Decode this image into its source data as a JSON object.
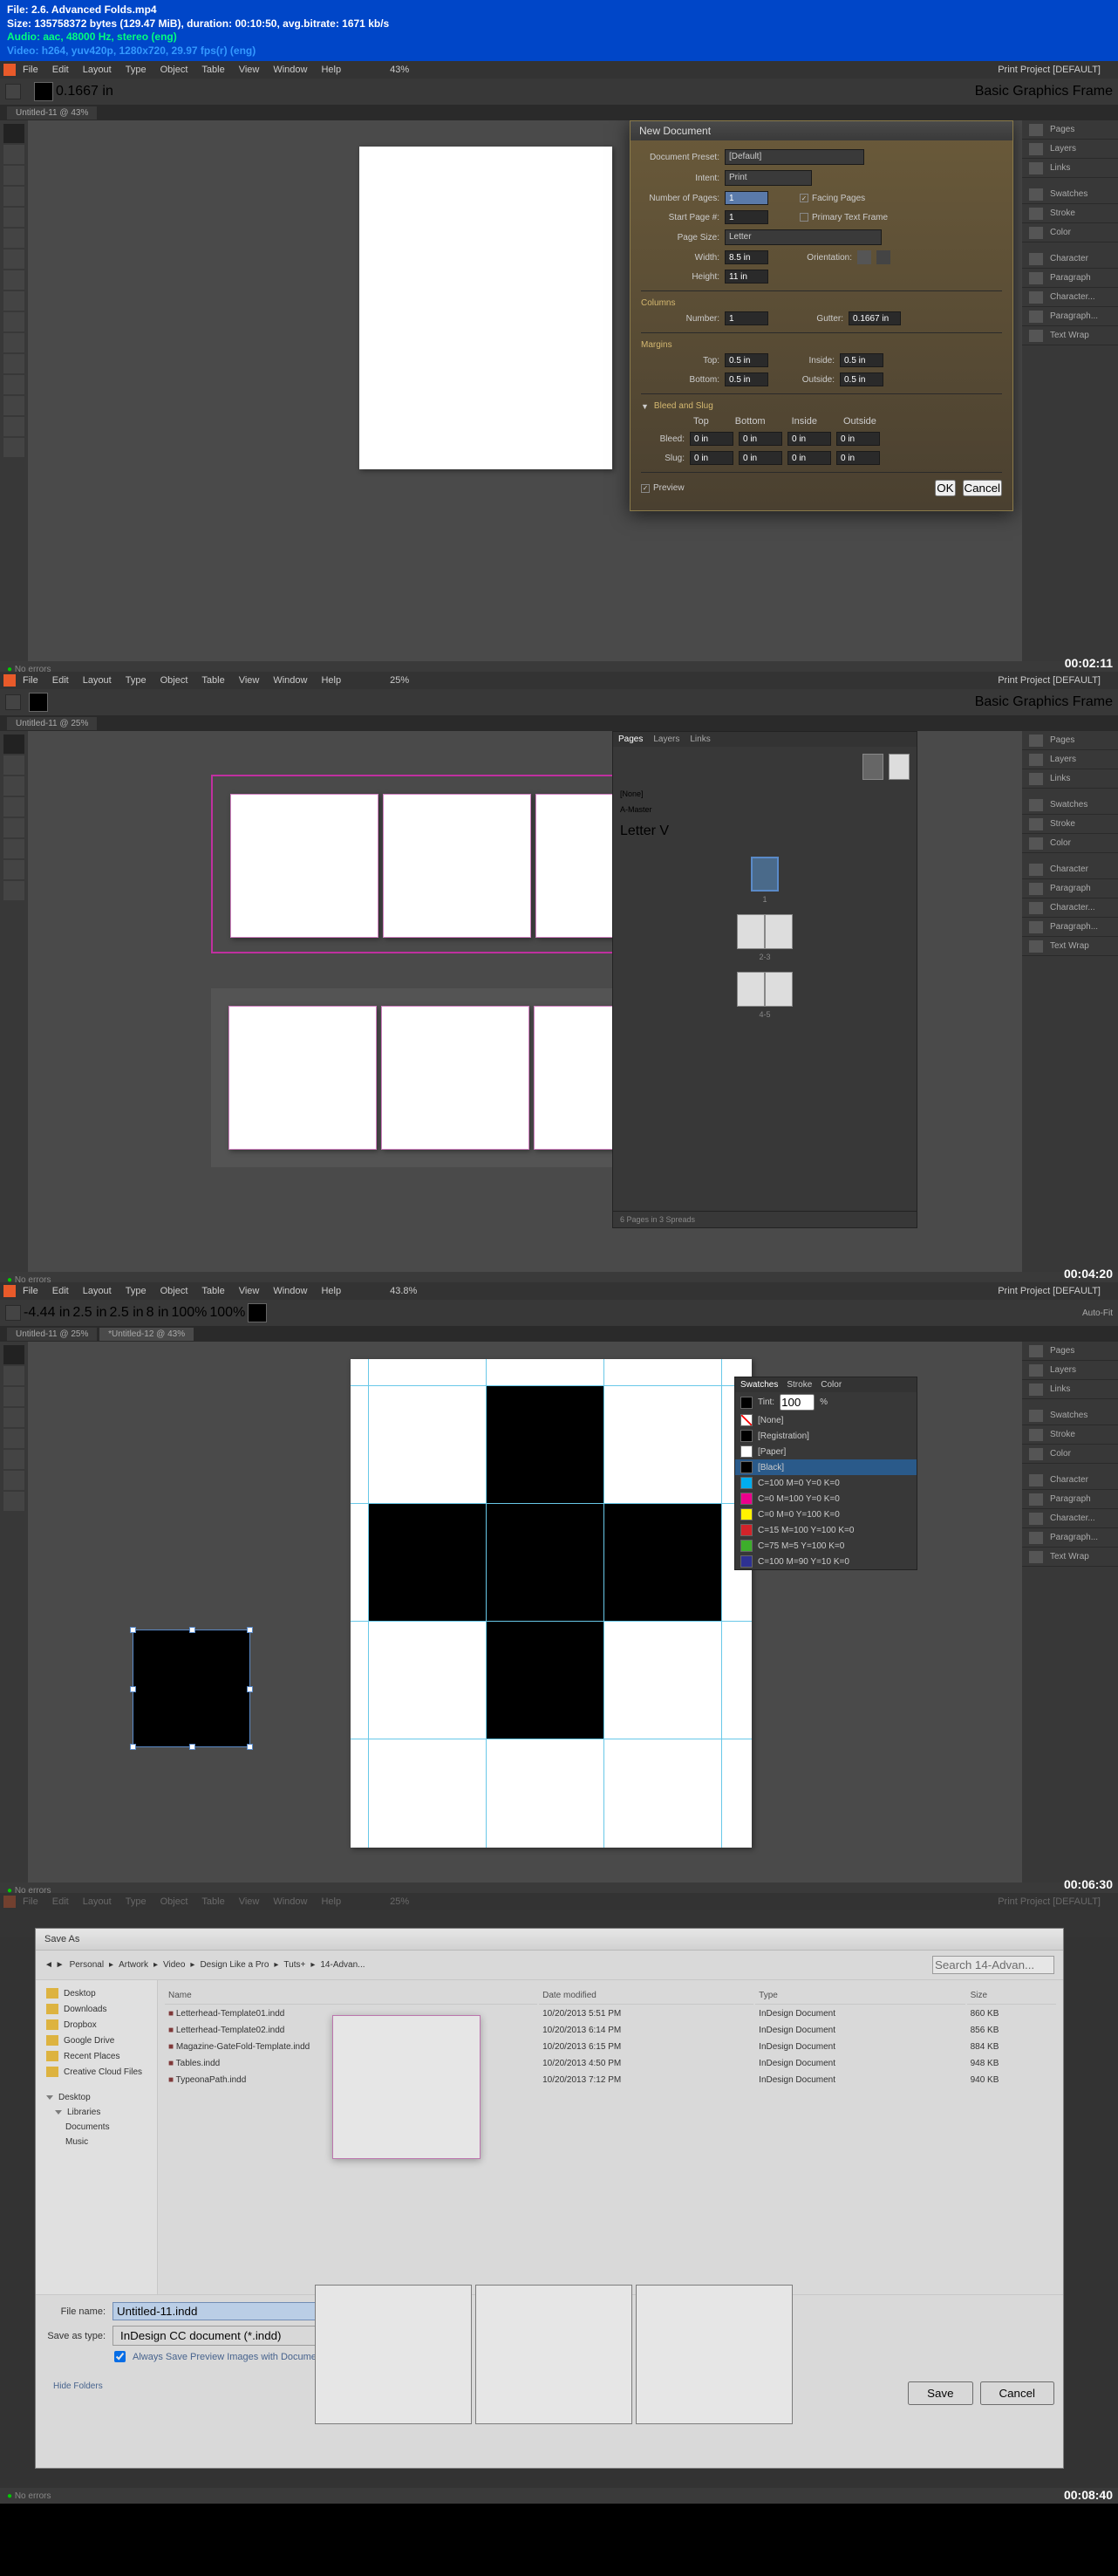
{
  "header": {
    "file": "File: 2.6. Advanced Folds.mp4",
    "size": "Size: 135758372 bytes (129.47 MiB), duration: 00:10:50, avg.bitrate: 1671 kb/s",
    "audio": "Audio: aac, 48000 Hz, stereo (eng)",
    "video": "Video: h264, yuv420p, 1280x720, 29.97 fps(r) (eng)"
  },
  "menubar": {
    "items": [
      "File",
      "Edit",
      "Layout",
      "Type",
      "Object",
      "Table",
      "View",
      "Window",
      "Help"
    ]
  },
  "frames": [
    {
      "zoom": "43%",
      "tab": "Untitled-11 @ 43%",
      "project": "Print Project [DEFAULT]",
      "timestamp": "00:02:11",
      "status": "No errors"
    },
    {
      "zoom": "25%",
      "tab": "Untitled-11 @ 25%",
      "project": "Print Project [DEFAULT]",
      "timestamp": "00:04:20",
      "status": "No errors",
      "pages_footer": "6 Pages in 3 Spreads"
    },
    {
      "zoom": "43.8%",
      "tab": "Untitled-11 @ 25%",
      "tab2": "*Untitled-12 @ 43%",
      "project": "Print Project [DEFAULT]",
      "timestamp": "00:06:30",
      "status": "No errors"
    },
    {
      "zoom": "25%",
      "project": "Print Project [DEFAULT]",
      "timestamp": "00:08:40",
      "status": "No errors"
    }
  ],
  "toolbar_values": {
    "x": "-4.44 in",
    "y": "2.5 in",
    "w": "2.5 in",
    "h": "8 in",
    "pct1": "100%",
    "pct2": "100%",
    "stroke": "0.1667 in",
    "frame_type": "Basic Graphics Frame",
    "autofit": "Auto-Fit"
  },
  "right_tabs": [
    "Pages",
    "Layers",
    "Links",
    "Swatches",
    "Stroke",
    "Color",
    "Character",
    "Paragraph",
    "Character...",
    "Paragraph...",
    "Text Wrap"
  ],
  "new_doc": {
    "title": "New Document",
    "preset_label": "Document Preset:",
    "preset_value": "[Default]",
    "intent_label": "Intent:",
    "intent_value": "Print",
    "num_pages_label": "Number of Pages:",
    "num_pages_value": "1",
    "facing_pages": "Facing Pages",
    "start_page_label": "Start Page #:",
    "start_page_value": "1",
    "primary_text": "Primary Text Frame",
    "page_size_label": "Page Size:",
    "page_size_value": "Letter",
    "width_label": "Width:",
    "width_value": "8.5 in",
    "height_label": "Height:",
    "height_value": "11 in",
    "orientation_label": "Orientation:",
    "columns_label": "Columns",
    "number_label": "Number:",
    "number_value": "1",
    "gutter_label": "Gutter:",
    "gutter_value": "0.1667 in",
    "margins_label": "Margins",
    "top_label": "Top:",
    "top_value": "0.5 in",
    "bottom_label": "Bottom:",
    "bottom_value": "0.5 in",
    "inside_label": "Inside:",
    "inside_value": "0.5 in",
    "outside_label": "Outside:",
    "outside_value": "0.5 in",
    "bleed_slug": "Bleed and Slug",
    "th_top": "Top",
    "th_bottom": "Bottom",
    "th_inside": "Inside",
    "th_outside": "Outside",
    "bleed_label": "Bleed:",
    "slug_label": "Slug:",
    "zero": "0 in",
    "preview": "Preview",
    "ok": "OK",
    "cancel": "Cancel"
  },
  "pages_panel": {
    "tabs": [
      "Pages",
      "Layers",
      "Links"
    ],
    "none": "[None]",
    "amaster": "A-Master",
    "select": "Letter V",
    "labels": [
      "1",
      "2-3",
      "4-5"
    ]
  },
  "swatches": {
    "tabs": [
      "Swatches",
      "Stroke",
      "Color"
    ],
    "tint_label": "Tint:",
    "tint_value": "100",
    "items": [
      {
        "name": "[None]",
        "color": "transparent"
      },
      {
        "name": "[Registration]",
        "color": "#000"
      },
      {
        "name": "[Paper]",
        "color": "#fff"
      },
      {
        "name": "[Black]",
        "color": "#000",
        "selected": true
      },
      {
        "name": "C=100 M=0 Y=0 K=0",
        "color": "#00aeef"
      },
      {
        "name": "C=0 M=100 Y=0 K=0",
        "color": "#ec008c"
      },
      {
        "name": "C=0 M=0 Y=100 K=0",
        "color": "#fff200"
      },
      {
        "name": "C=15 M=100 Y=100 K=0",
        "color": "#d2232a"
      },
      {
        "name": "C=75 M=5 Y=100 K=0",
        "color": "#3dae2b"
      },
      {
        "name": "C=100 M=90 Y=10 K=0",
        "color": "#2e3192"
      }
    ]
  },
  "save_dialog": {
    "title": "Save As",
    "path": [
      "Personal",
      "Artwork",
      "Video",
      "Design Like a Pro",
      "Tuts+",
      "14-Advan..."
    ],
    "search_placeholder": "Search 14-Advan...",
    "sidebar": [
      "Desktop",
      "Downloads",
      "Dropbox",
      "Google Drive",
      "Recent Places",
      "Creative Cloud Files",
      "Desktop",
      "Libraries",
      "Documents",
      "Music"
    ],
    "th_name": "Name",
    "th_date": "Date modified",
    "th_type": "Type",
    "th_size": "Size",
    "files": [
      {
        "name": "Letterhead-Template01.indd",
        "date": "10/20/2013 5:51 PM",
        "type": "InDesign Document",
        "size": "860 KB"
      },
      {
        "name": "Letterhead-Template02.indd",
        "date": "10/20/2013 6:14 PM",
        "type": "InDesign Document",
        "size": "856 KB"
      },
      {
        "name": "Magazine-GateFold-Template.indd",
        "date": "10/20/2013 6:15 PM",
        "type": "InDesign Document",
        "size": "884 KB"
      },
      {
        "name": "Tables.indd",
        "date": "10/20/2013 4:50 PM",
        "type": "InDesign Document",
        "size": "948 KB"
      },
      {
        "name": "TypeonaPath.indd",
        "date": "10/20/2013 7:12 PM",
        "type": "InDesign Document",
        "size": "940 KB"
      }
    ],
    "filename_label": "File name:",
    "filename_value": "Untitled-11.indd",
    "saveas_label": "Save as type:",
    "saveas_value": "InDesign CC document (*.indd)",
    "always_save": "Always Save Preview Images with Documents",
    "hide_folders": "Hide Folders",
    "save": "Save",
    "cancel": "Cancel"
  }
}
